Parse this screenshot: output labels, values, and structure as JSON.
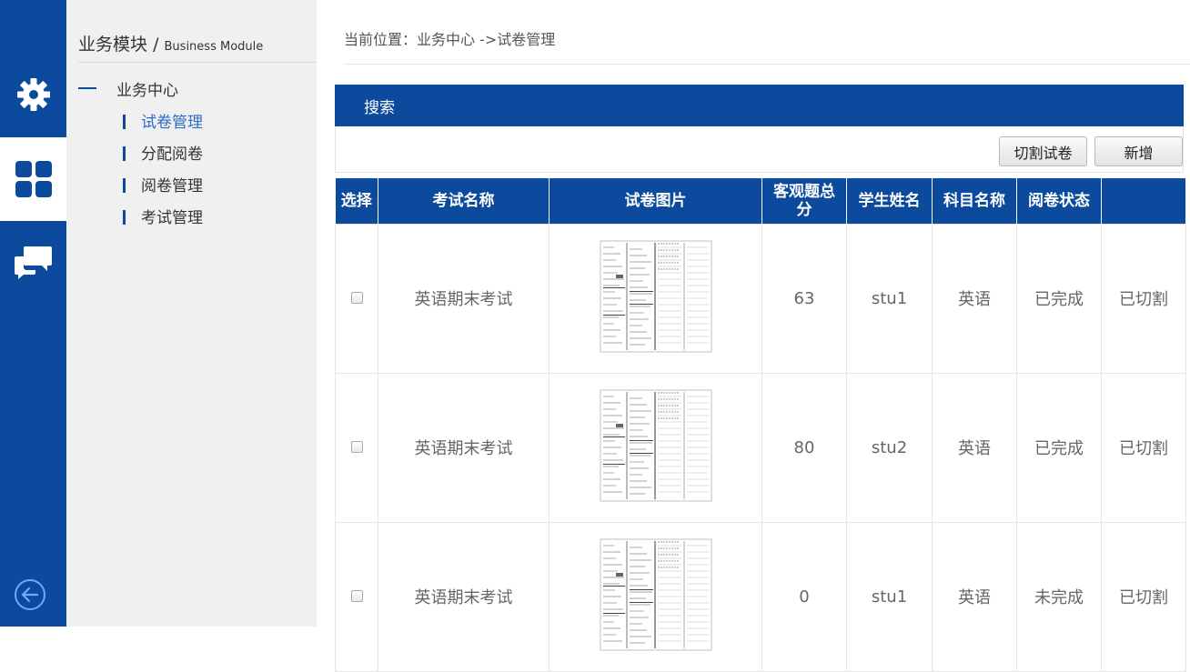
{
  "rail": {
    "items": [
      {
        "name": "settings",
        "icon": "gear-icon"
      },
      {
        "name": "modules",
        "icon": "grid-icon"
      },
      {
        "name": "messages",
        "icon": "chat-icon"
      }
    ],
    "back_icon": "arrow-left-circle-icon"
  },
  "menu": {
    "title": "业务模块",
    "separator": "/",
    "subtitle": "Business Module",
    "group_label": "业务中心",
    "items": [
      {
        "label": "试卷管理",
        "active": true
      },
      {
        "label": "分配阅卷",
        "active": false
      },
      {
        "label": "阅卷管理",
        "active": false
      },
      {
        "label": "考试管理",
        "active": false
      }
    ]
  },
  "breadcrumb": "当前位置：业务中心 ->试卷管理",
  "search": {
    "title": "搜索",
    "buttons": {
      "cut": "切割试卷",
      "add": "新增"
    }
  },
  "table": {
    "headers": [
      "选择",
      "考试名称",
      "试卷图片",
      "客观题总分",
      "学生姓名",
      "科目名称",
      "阅卷状态",
      ""
    ],
    "rows": [
      {
        "exam": "英语期末考试",
        "score": "63",
        "student": "stu1",
        "subject": "英语",
        "status": "已完成",
        "status_color": "#e0161b",
        "cut": "已切割"
      },
      {
        "exam": "英语期末考试",
        "score": "80",
        "student": "stu2",
        "subject": "英语",
        "status": "已完成",
        "status_color": "#e0161b",
        "cut": "已切割"
      },
      {
        "exam": "英语期末考试",
        "score": "0",
        "student": "stu1",
        "subject": "英语",
        "status": "未完成",
        "status_color": "#1b8a1b",
        "cut": "已切割"
      }
    ]
  },
  "colors": {
    "primary": "#0b4a9c",
    "active_link": "#2d6bc8",
    "done": "#e0161b",
    "undone": "#1b8a1b"
  }
}
